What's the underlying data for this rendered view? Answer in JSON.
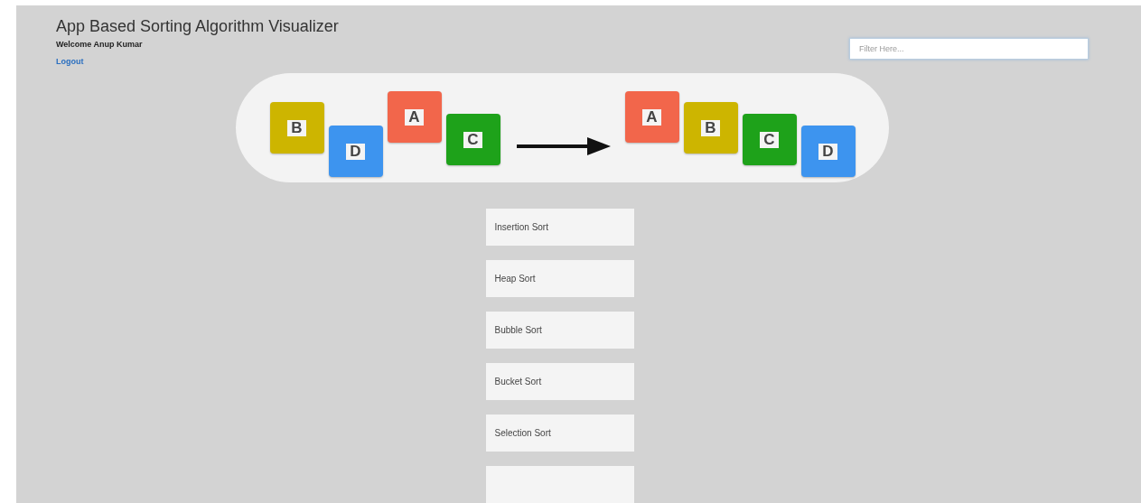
{
  "header": {
    "title": "App Based Sorting Algorithm Visualizer",
    "welcome": "Welcome Anup Kumar",
    "logout": "Logout"
  },
  "filter": {
    "placeholder": "Filter Here..."
  },
  "banner": {
    "unsorted": [
      {
        "label": "B",
        "color": "#cdb500"
      },
      {
        "label": "D",
        "color": "#3d94ef"
      },
      {
        "label": "A",
        "color": "#f2664b"
      },
      {
        "label": "C",
        "color": "#1ea21a"
      }
    ],
    "sorted": [
      {
        "label": "A",
        "color": "#f2664b"
      },
      {
        "label": "B",
        "color": "#cdb500"
      },
      {
        "label": "C",
        "color": "#1ea21a"
      },
      {
        "label": "D",
        "color": "#3d94ef"
      }
    ]
  },
  "algorithms": [
    "Insertion Sort",
    "Heap Sort",
    "Bubble Sort",
    "Bucket Sort",
    "Selection Sort"
  ]
}
